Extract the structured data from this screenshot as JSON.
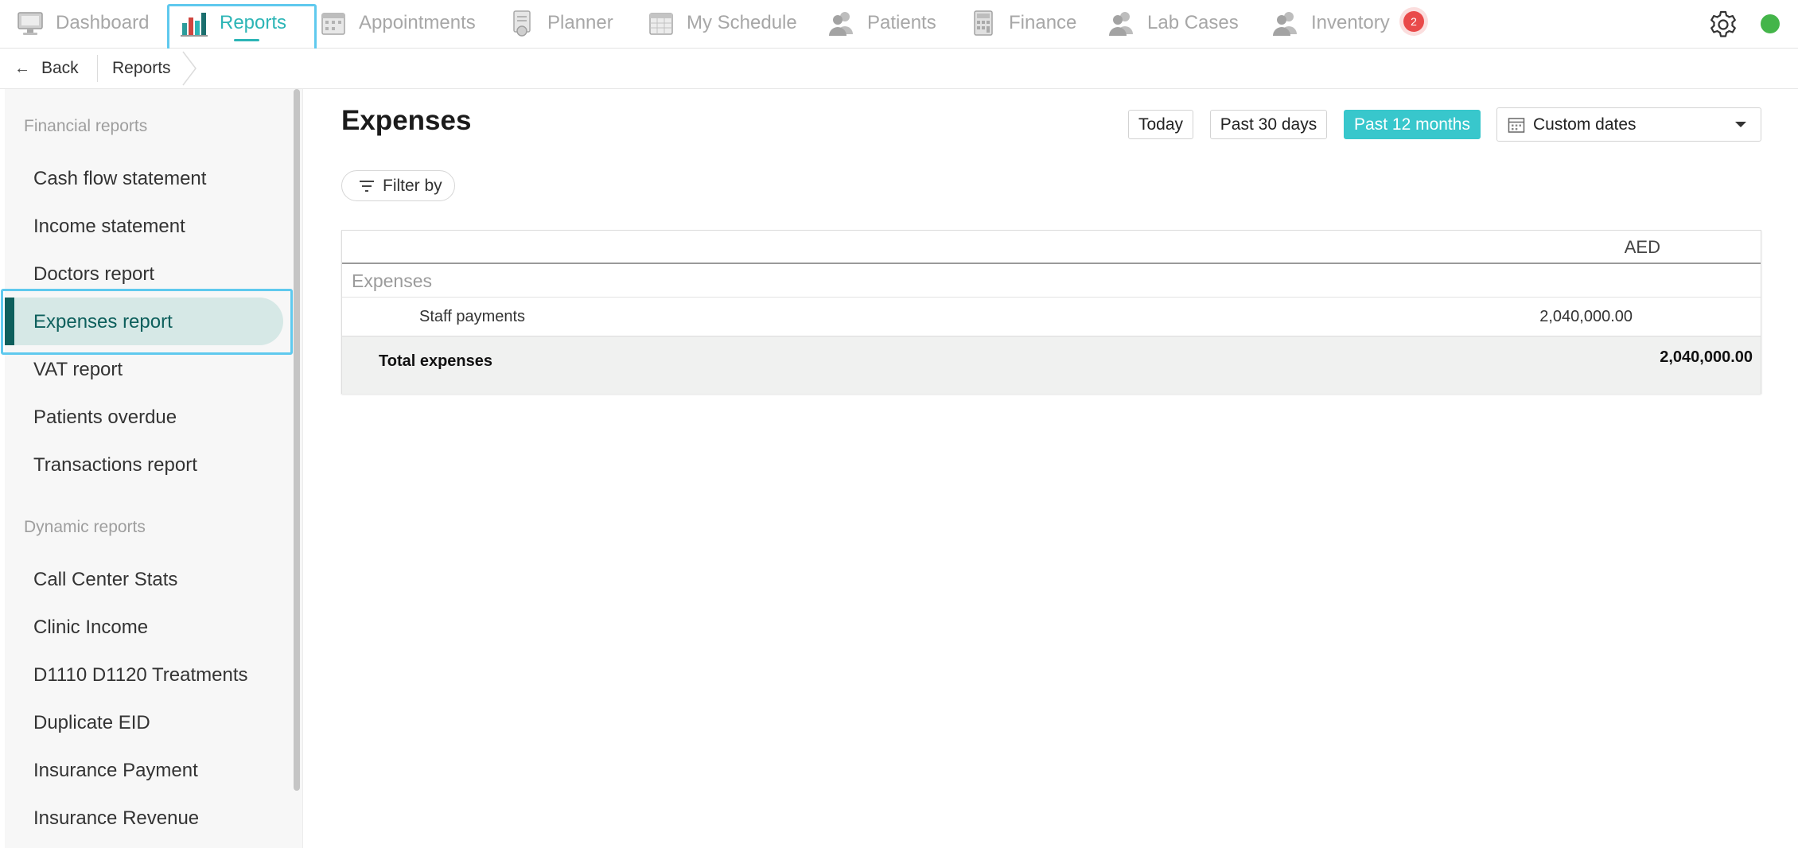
{
  "nav": {
    "items": [
      {
        "label": "Dashboard",
        "icon": "monitor-icon"
      },
      {
        "label": "Reports",
        "icon": "bar-chart-icon",
        "active": true
      },
      {
        "label": "Appointments",
        "icon": "calendar-icon"
      },
      {
        "label": "Planner",
        "icon": "planner-icon"
      },
      {
        "label": "My Schedule",
        "icon": "schedule-icon"
      },
      {
        "label": "Patients",
        "icon": "users-icon"
      },
      {
        "label": "Finance",
        "icon": "calculator-icon"
      },
      {
        "label": "Lab Cases",
        "icon": "users-icon"
      },
      {
        "label": "Inventory",
        "icon": "users-icon"
      }
    ],
    "inventory_badge": "2",
    "accent_color": "#2cb5b6",
    "status_color": "#44b54a"
  },
  "breadcrumb": {
    "back_label": "Back",
    "current": "Reports"
  },
  "sidebar": {
    "financial_heading": "Financial reports",
    "financial_items": [
      "Cash flow statement",
      "Income statement",
      "Doctors report",
      "Expenses report",
      "VAT report",
      "Patients overdue",
      "Transactions report"
    ],
    "active_item": "Expenses report",
    "dynamic_heading": "Dynamic reports",
    "dynamic_items": [
      "Call Center Stats",
      "Clinic Income",
      "D1110 D1120 Treatments",
      "Duplicate EID",
      "Insurance Payment",
      "Insurance Revenue"
    ]
  },
  "main": {
    "title": "Expenses",
    "ranges": {
      "today": "Today",
      "past30": "Past 30 days",
      "past12": "Past 12 months",
      "selected": "Past 12 months"
    },
    "custom_dates": "Custom dates",
    "filter_label": "Filter by",
    "table": {
      "currency": "AED",
      "group": "Expenses",
      "rows": [
        {
          "label": "Staff payments",
          "value": "2,040,000.00"
        }
      ],
      "total_label": "Total expenses",
      "total_value": "2,040,000.00"
    }
  }
}
